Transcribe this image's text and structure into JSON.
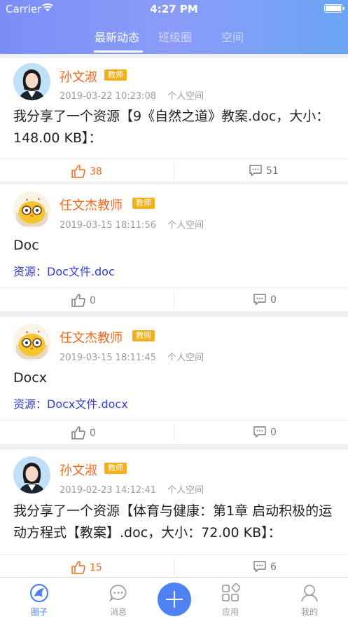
{
  "status_bar": {
    "carrier": "Carrier",
    "time": "4:27 PM"
  },
  "tabs": [
    {
      "label": "最新动态",
      "active": true
    },
    {
      "label": "班级圈",
      "active": false
    },
    {
      "label": "空间",
      "active": false
    }
  ],
  "posts": [
    {
      "author": "孙文淑",
      "role": "教师",
      "datetime": "2019-03-22 10:23:08",
      "location": "个人空间",
      "content": "我分享了一个资源【9《自然之道》教案.doc，大小：148.00 KB】：",
      "likes": "38",
      "comments": "51",
      "liked": true,
      "avatar_icon": "girl-portrait-avatar"
    },
    {
      "author": "任文杰教师",
      "role": "教师",
      "datetime": "2019-03-15 18:11:56",
      "location": "个人空间",
      "content": "Doc",
      "resource_label": "资源：",
      "resource_name": "Doc文件.doc",
      "likes": "0",
      "comments": "0",
      "liked": false,
      "avatar_icon": "cartoon-owl-avatar"
    },
    {
      "author": "任文杰教师",
      "role": "教师",
      "datetime": "2019-03-15 18:11:45",
      "location": "个人空间",
      "content": "Docx",
      "resource_label": "资源：",
      "resource_name": "Docx文件.docx",
      "likes": "0",
      "comments": "0",
      "liked": false,
      "avatar_icon": "cartoon-owl-avatar"
    },
    {
      "author": "孙文淑",
      "role": "教师",
      "datetime": "2019-02-23 14:12:41",
      "location": "个人空间",
      "content": "我分享了一个资源【体育与健康：第1章 启动积极的运动方程式【教案】.doc，大小：72.00 KB】：",
      "likes": "15",
      "comments": "6",
      "liked": true,
      "avatar_icon": "girl-portrait-avatar"
    }
  ],
  "tabbar": [
    {
      "label": "圈子",
      "icon": "circle-icon",
      "active": true
    },
    {
      "label": "消息",
      "icon": "message-icon",
      "active": false
    },
    {
      "label": "",
      "icon": "plus-icon",
      "active": false
    },
    {
      "label": "应用",
      "icon": "apps-icon",
      "active": false
    },
    {
      "label": "我的",
      "icon": "profile-icon",
      "active": false
    }
  ],
  "colors": {
    "header_gradient_start": "#7c8ef6",
    "header_gradient_end": "#6aa4f6",
    "author_name": "#f26a1b",
    "badge": "#f4b018",
    "resource_link": "#2f3bd6",
    "tab_active": "#4e82f3"
  }
}
